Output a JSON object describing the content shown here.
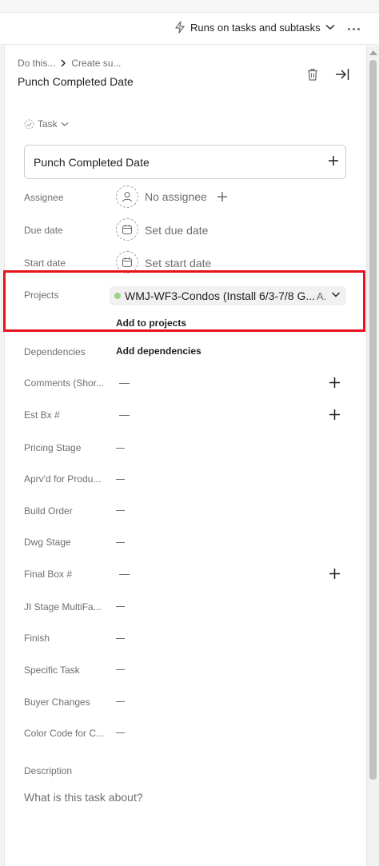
{
  "toolbar": {
    "runs_label": "Runs on tasks and subtasks"
  },
  "header": {
    "breadcrumb": [
      "Do this...",
      "Create su..."
    ],
    "title": "Punch Completed Date"
  },
  "task_type": "Task",
  "task_name": "Punch Completed Date",
  "fields": {
    "assignee": {
      "label": "Assignee",
      "value": "No assignee"
    },
    "due_date": {
      "label": "Due date",
      "value": "Set due date"
    },
    "start_date": {
      "label": "Start date",
      "value": "Set start date"
    },
    "projects": {
      "label": "Projects",
      "project_name": "WMJ-WF3-Condos (Install 6/3-7/8 G...",
      "section_abbr": "A.",
      "add_label": "Add to projects",
      "dot_color": "#9dd27f"
    },
    "dependencies": {
      "label": "Dependencies",
      "value": "Add dependencies"
    }
  },
  "custom_fields": [
    {
      "label": "Comments (Shor...",
      "value": "—",
      "has_plus": true
    },
    {
      "label": "Est Bx #",
      "value": "—",
      "has_plus": true
    },
    {
      "label": "Pricing Stage",
      "value": "—",
      "has_plus": false
    },
    {
      "label": "Aprv'd for Produ...",
      "value": "—",
      "has_plus": false
    },
    {
      "label": "Build Order",
      "value": "—",
      "has_plus": false
    },
    {
      "label": "Dwg Stage",
      "value": "—",
      "has_plus": false
    },
    {
      "label": "Final Box #",
      "value": "—",
      "has_plus": true
    },
    {
      "label": "JI Stage MultiFa...",
      "value": "—",
      "has_plus": false
    },
    {
      "label": "Finish",
      "value": "—",
      "has_plus": false
    },
    {
      "label": "Specific Task",
      "value": "—",
      "has_plus": false
    },
    {
      "label": "Buyer Changes",
      "value": "—",
      "has_plus": false
    },
    {
      "label": "Color Code for C...",
      "value": "—",
      "has_plus": false
    }
  ],
  "description": {
    "label": "Description",
    "placeholder": "What is this task about?"
  },
  "colors": {
    "highlight": "#e8121b",
    "text_primary": "#1e1f21",
    "text_secondary": "#6d6e6f"
  }
}
